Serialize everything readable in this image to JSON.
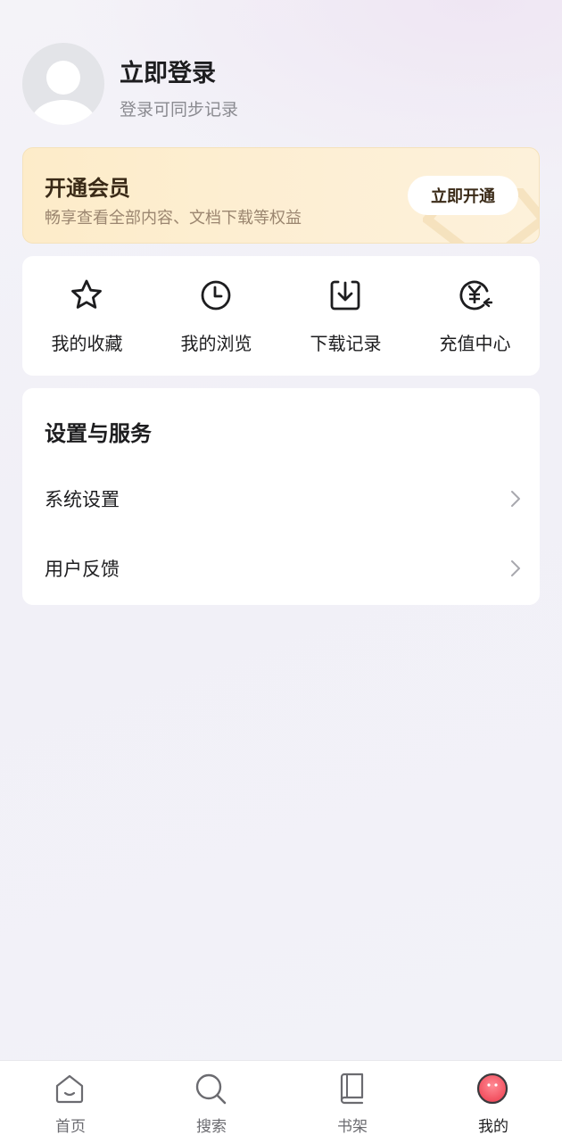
{
  "profile": {
    "title": "立即登录",
    "subtitle": "登录可同步记录"
  },
  "vip": {
    "title": "开通会员",
    "subtitle": "畅享查看全部内容、文档下载等权益",
    "button": "立即开通"
  },
  "actions": [
    {
      "label": "我的收藏",
      "icon": "star-icon"
    },
    {
      "label": "我的浏览",
      "icon": "clock-icon"
    },
    {
      "label": "下载记录",
      "icon": "download-icon"
    },
    {
      "label": "充值中心",
      "icon": "yuan-icon"
    }
  ],
  "settings": {
    "title": "设置与服务",
    "items": [
      {
        "label": "系统设置"
      },
      {
        "label": "用户反馈"
      }
    ]
  },
  "tabbar": {
    "items": [
      {
        "label": "首页",
        "icon": "home-icon"
      },
      {
        "label": "搜索",
        "icon": "search-icon"
      },
      {
        "label": "书架",
        "icon": "book-icon"
      },
      {
        "label": "我的",
        "icon": "profile-icon",
        "active": true
      }
    ]
  },
  "colors": {
    "accent": "#f25c6a",
    "vip_bg": "#fdecc9",
    "text": "#1d1d1f",
    "muted": "#8a8a90"
  }
}
